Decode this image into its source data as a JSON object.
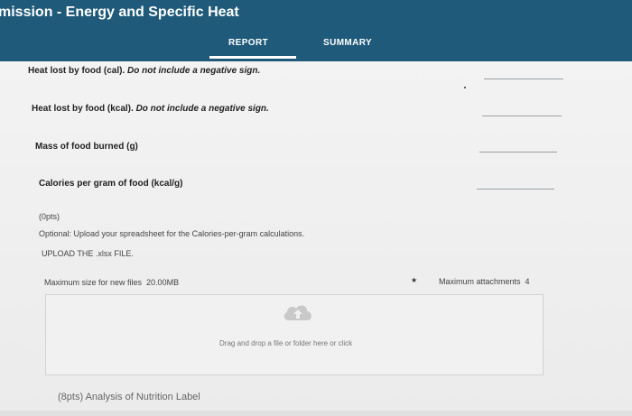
{
  "header": {
    "title": "mission - Energy and Specific Heat",
    "tabs": [
      "REPORT",
      "SUMMARY"
    ]
  },
  "questions": [
    {
      "label": "Heat lost by food (cal).",
      "note": " Do not include a negative sign."
    },
    {
      "label": "Heat lost by food (kcal).",
      "note": " Do not include a negative sign."
    },
    {
      "label": "Mass of food burned (g)",
      "note": ""
    },
    {
      "label": "Calories per gram of food (kcal/g)",
      "note": ""
    }
  ],
  "upload": {
    "points": "(0pts)",
    "instructions": "Optional: Upload your spreadsheet for the Calories-per-gram calculations.",
    "file_instruction": "UPLOAD THE .xlsx FILE.",
    "max_size_label": "Maximum size for new files",
    "max_size_value": "20.00MB",
    "max_attachments_label": "Maximum attachments",
    "max_attachments_value": "4",
    "drop_text": "Drag and drop a file or folder here or click"
  },
  "next_section": "(8pts) Analysis of Nutrition Label",
  "colors": {
    "header": "#1f5a7a",
    "background": "#ececec"
  },
  "icons": {
    "upload": "upload-cloud-icon"
  }
}
